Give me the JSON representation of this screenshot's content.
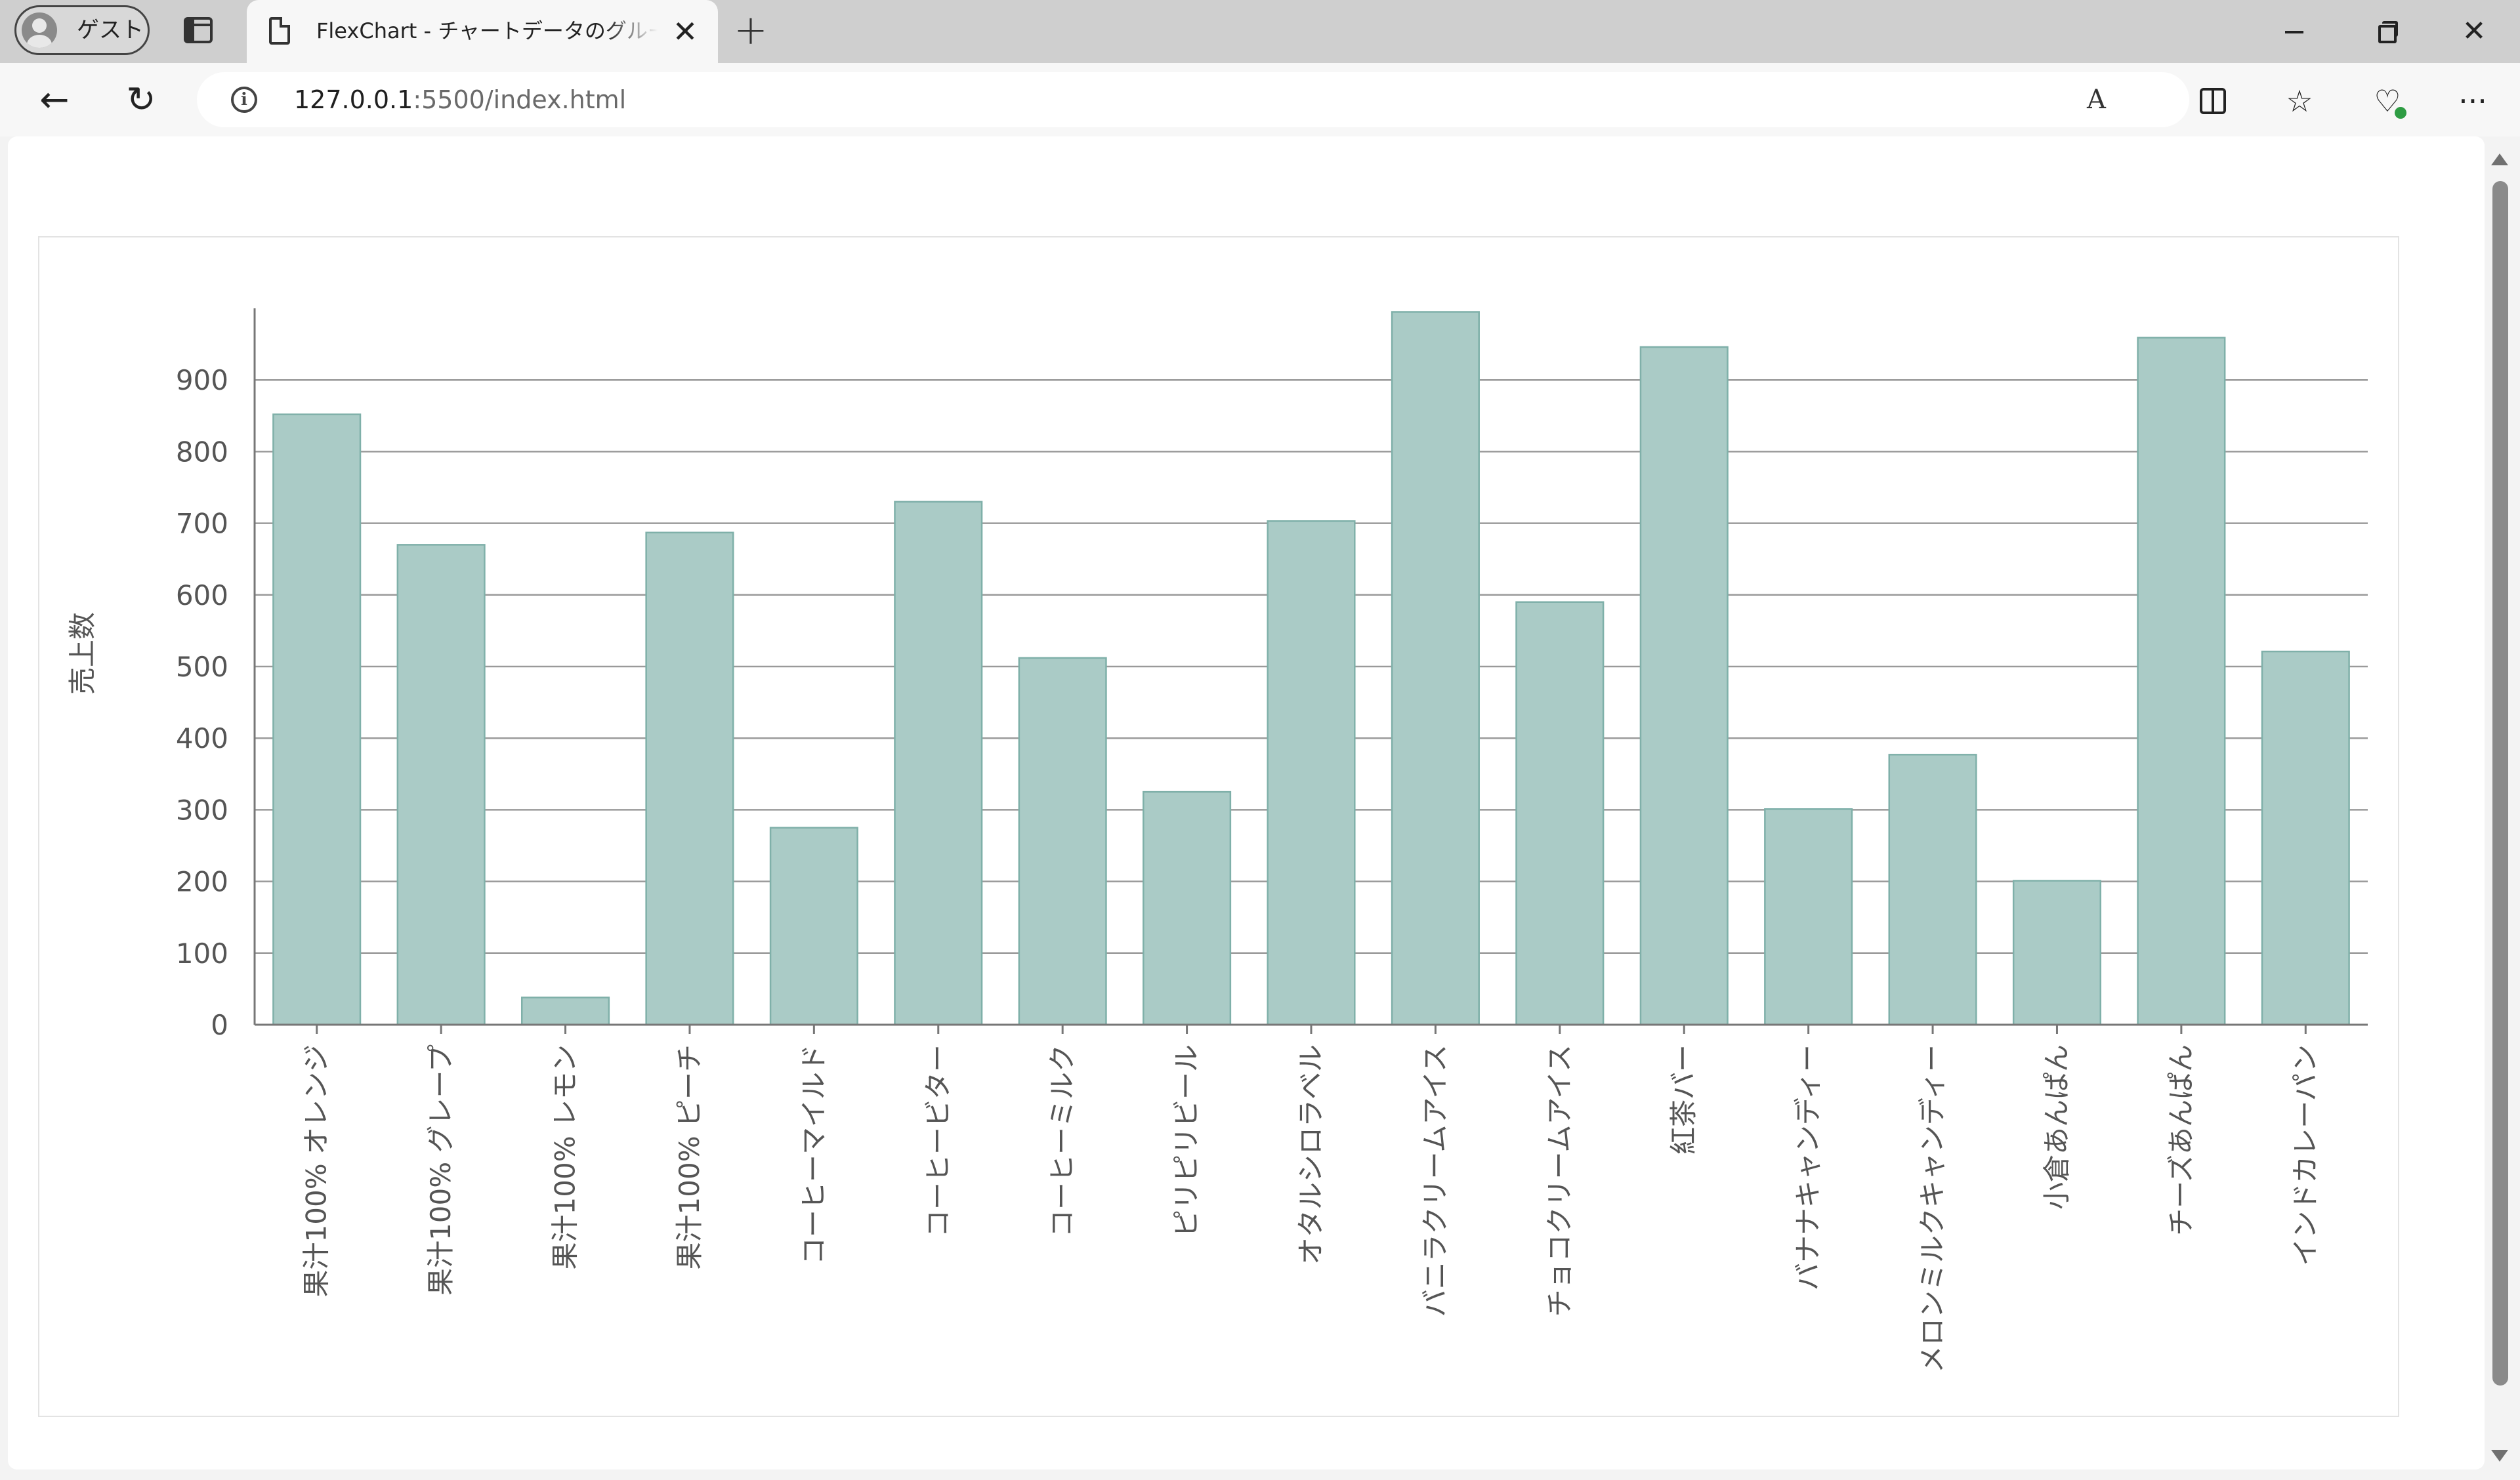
{
  "browser": {
    "profile_label": "ゲスト",
    "tab_title": "FlexChart - チャートデータのグループ化",
    "url_host": "127.0.0.1",
    "url_rest": ":5500/index.html",
    "icons": {
      "profile": "person-icon",
      "tabs": "tab-actions-icon",
      "tab_page": "page-icon",
      "close_tab": "close-icon",
      "new_tab": "plus-icon",
      "back": "arrow-left-icon",
      "reload": "reload-icon",
      "info": "info-icon",
      "read_aloud": "read-aloud-icon",
      "split": "split-screen-icon",
      "favorites": "favorites-icon",
      "health": "browser-essentials-icon",
      "more": "more-icon"
    },
    "glyphs": {
      "close": "✕",
      "plus": "+",
      "back": "←",
      "reload": "↻",
      "info": "i",
      "read_aloud": "A",
      "favorites": "☆",
      "health": "♡",
      "more": "···",
      "win_close": "✕"
    }
  },
  "chart_data": {
    "type": "bar",
    "ylabel": "売上数",
    "ylim": [
      0,
      1000
    ],
    "yticks": [
      0,
      100,
      200,
      300,
      400,
      500,
      600,
      700,
      800,
      900
    ],
    "grid": true,
    "bar_color": "#aacbc6",
    "bar_stroke": "#7fb0a9",
    "categories": [
      "果汁100% オレンジ",
      "果汁100% グレープ",
      "果汁100% レモン",
      "果汁100% ピーチ",
      "コーヒーマイルド",
      "コーヒービター",
      "コーヒーミルク",
      "ピリピリビール",
      "オタルシロラベル",
      "バニラクリームアイス",
      "チョコクリームアイス",
      "紅茶バー",
      "バナナキャンディー",
      "メロンミルクキャンディー",
      "小倉あんぱん",
      "チーズあんぱん",
      "インドカレーパン"
    ],
    "values": [
      852,
      670,
      38,
      687,
      275,
      730,
      512,
      325,
      703,
      995,
      590,
      946,
      301,
      377,
      201,
      959,
      521
    ]
  }
}
